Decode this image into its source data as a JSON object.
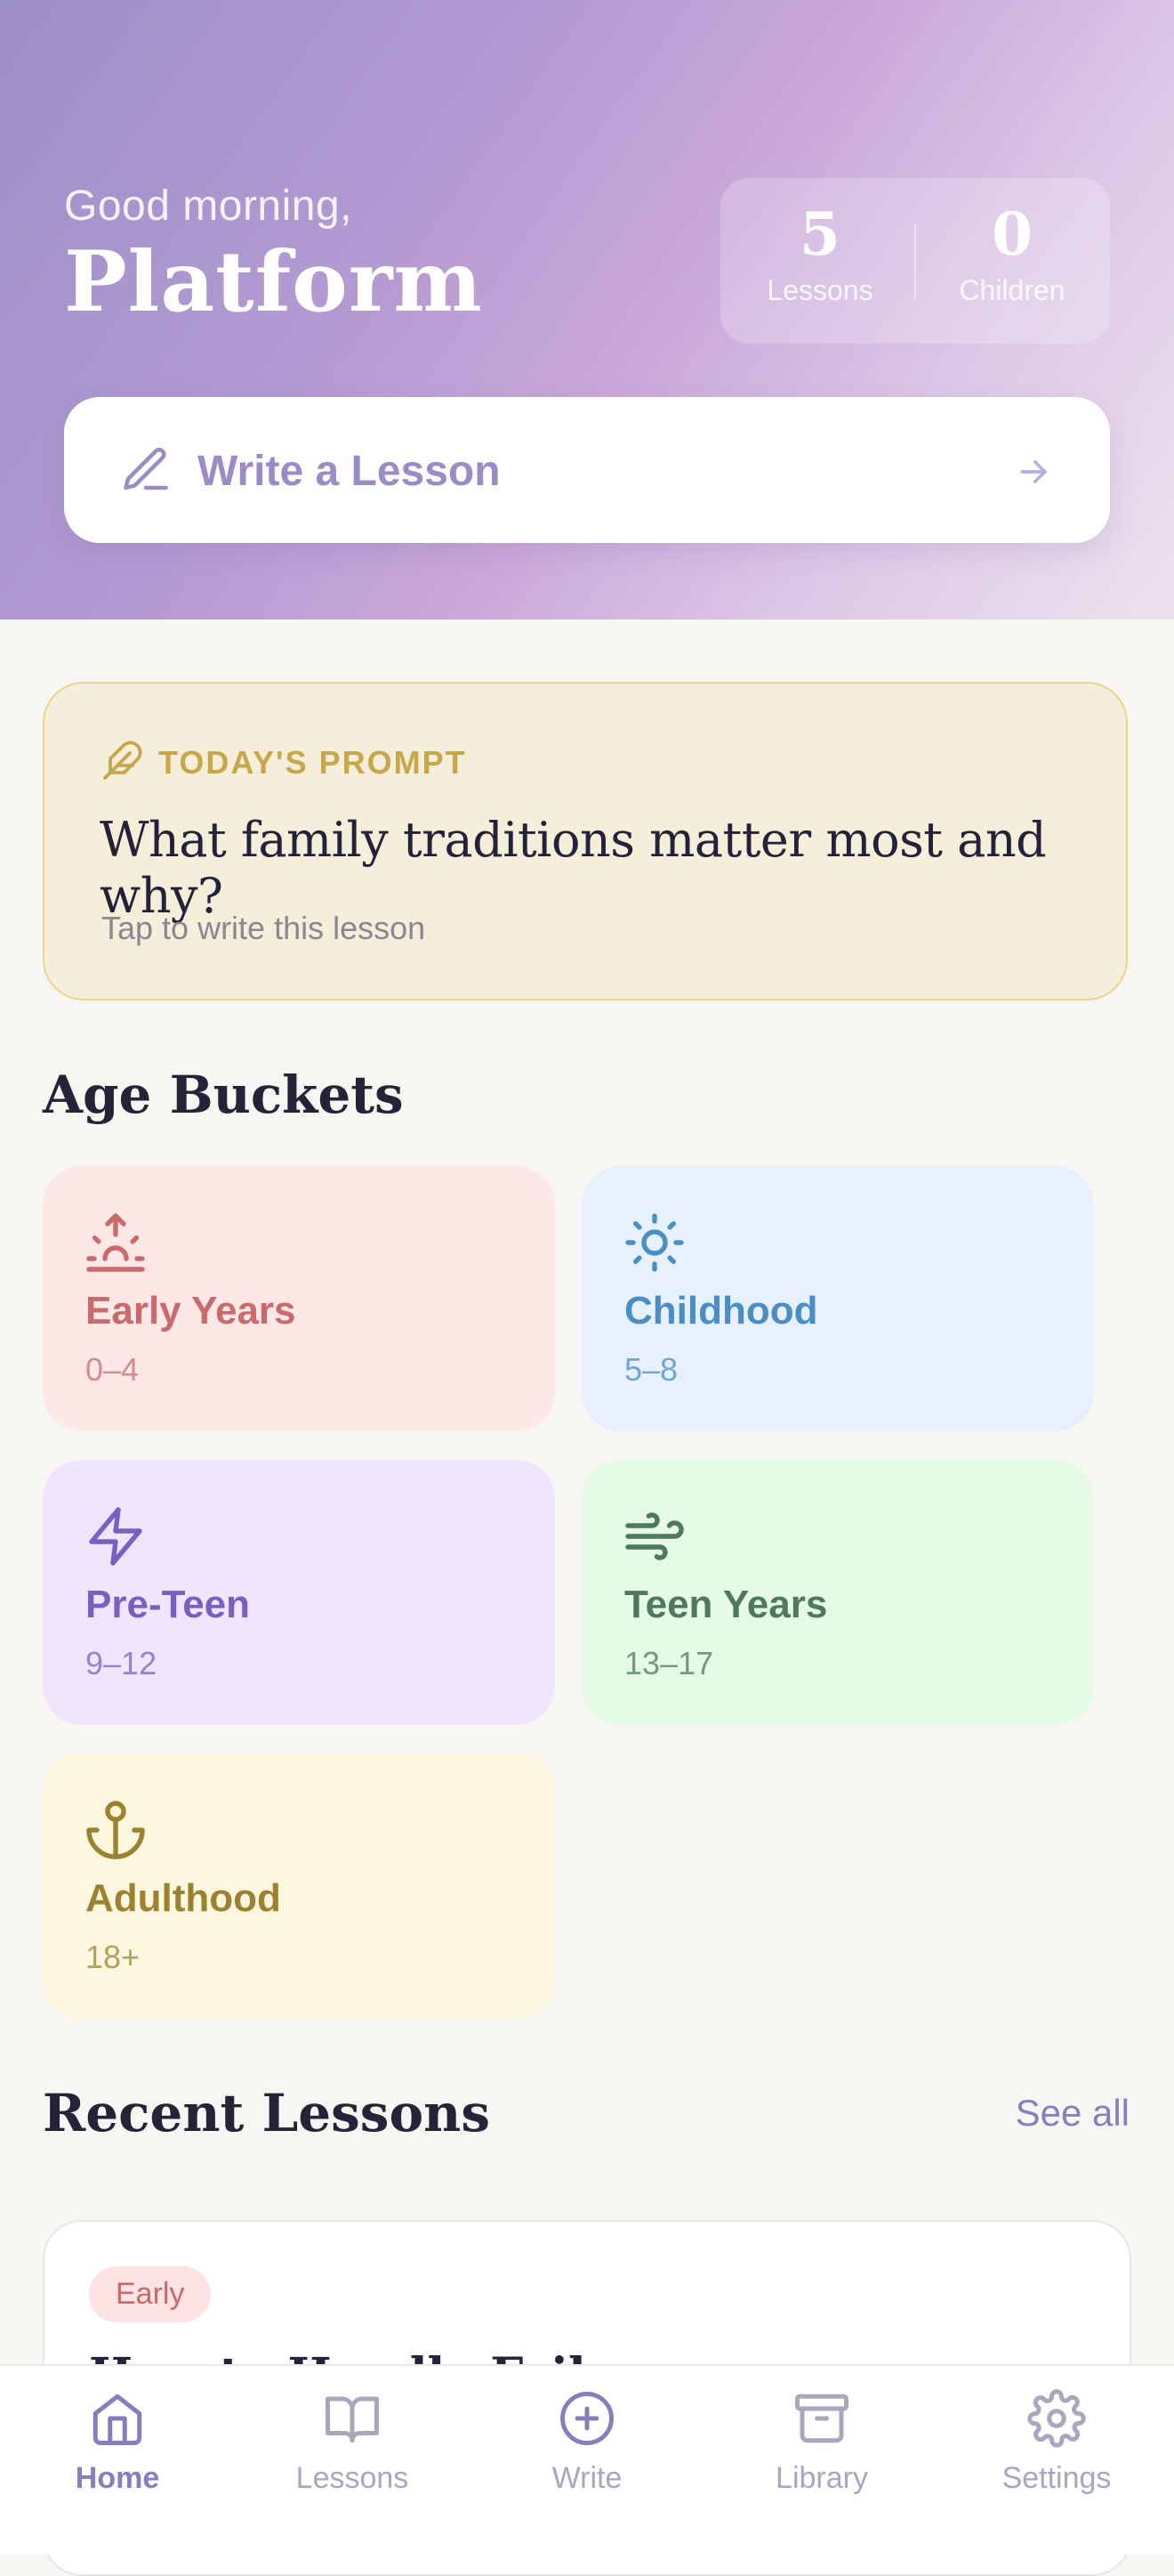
{
  "header": {
    "greeting": "Good morning,",
    "name": "Platform",
    "stats": [
      {
        "value": "5",
        "label": "Lessons"
      },
      {
        "value": "0",
        "label": "Children"
      }
    ],
    "write_button": "Write a Lesson"
  },
  "prompt": {
    "tag": "TODAY'S PROMPT",
    "question": "What family traditions matter most and why?",
    "hint": "Tap to write this lesson"
  },
  "age_buckets": {
    "title": "Age Buckets",
    "items": [
      {
        "title": "Early Years",
        "range": "0–4",
        "icon": "sunrise-icon",
        "bg": "#fde7e7",
        "color": "#c96b6b"
      },
      {
        "title": "Childhood",
        "range": "5–8",
        "icon": "sun-icon",
        "bg": "#e6f1fd",
        "color": "#4b8ec6"
      },
      {
        "title": "Pre-Teen",
        "range": "9–12",
        "icon": "lightning-icon",
        "bg": "#efe6fd",
        "color": "#7a5fc2"
      },
      {
        "title": "Teen Years",
        "range": "13–17",
        "icon": "wind-icon",
        "bg": "#e6fbe6",
        "color": "#4e7a5c"
      },
      {
        "title": "Adulthood",
        "range": "18+",
        "icon": "anchor-icon",
        "bg": "#fdf7e0",
        "color": "#9c8230"
      }
    ]
  },
  "recent": {
    "title": "Recent Lessons",
    "see_all": "See all",
    "lessons": [
      {
        "badge": "Early",
        "title": "How to Handle Fail"
      }
    ]
  },
  "tabs": [
    {
      "label": "Home",
      "icon": "home-icon",
      "active": true
    },
    {
      "label": "Lessons",
      "icon": "book-icon",
      "active": false
    },
    {
      "label": "Write",
      "icon": "plus-circle-icon",
      "active": false
    },
    {
      "label": "Library",
      "icon": "archive-icon",
      "active": false
    },
    {
      "label": "Settings",
      "icon": "gear-icon",
      "active": false
    }
  ],
  "colors": {
    "accent": "#8a7dbd",
    "prompt_tag": "#c8a64a",
    "background": "#f8f6f3"
  }
}
